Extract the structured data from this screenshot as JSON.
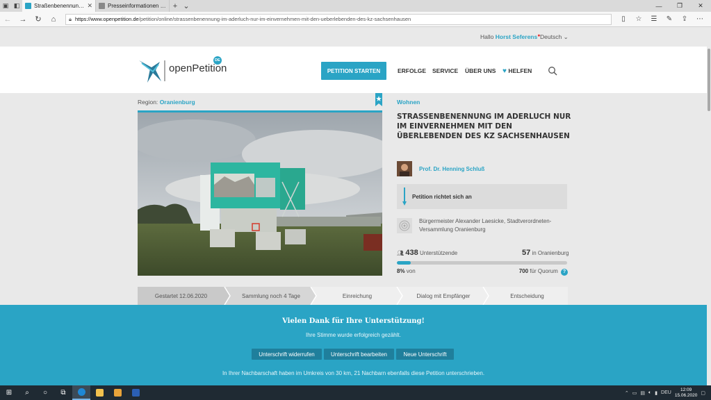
{
  "browser": {
    "tabs": [
      {
        "title": "Straßenbenennung im A",
        "active": true
      },
      {
        "title": "Presseinformationen - Stiftu",
        "active": false
      }
    ],
    "url_base": "https://www.openpetition.de",
    "url_path": "/petition/online/strassenbenennung-im-aderluch-nur-im-einvernehmen-mit-den-ueberlebenden-des-kz-sachsenhausen"
  },
  "userbar": {
    "greeting": "Hallo",
    "username": "Horst Seferens",
    "language": "Deutsch"
  },
  "header": {
    "logo_text": "openPetition",
    "logo_badge": "DE",
    "start_label": "PETITION STARTEN",
    "nav": [
      "ERFOLGE",
      "SERVICE",
      "ÜBER UNS",
      "HELFEN"
    ]
  },
  "petition": {
    "region_label": "Region:",
    "region": "Oranienburg",
    "category": "Wohnen",
    "title": "Straßenbenennung im Aderluch nur im Einvernehmen mit den Überlebenden des KZ Sachsenhausen",
    "author": "Prof. Dr. Henning Schluß",
    "target_label": "Petition richtet sich an",
    "recipient": "Bürgermeister Alexander Laesicke, Stadtverordneten-Versammlung Oranienburg"
  },
  "stats": {
    "supporters": "438",
    "supporters_label": "Unterstützende",
    "local": "57",
    "local_label": "in Oranienburg",
    "percent": "8%",
    "percent_label": "von",
    "progress": 0.08,
    "quorum": "700",
    "quorum_label": "für Quorum",
    "help": "?"
  },
  "stages": [
    {
      "label": "Gestartet 12.06.2020",
      "state": "done"
    },
    {
      "label": "Sammlung noch 4 Tage",
      "state": "current"
    },
    {
      "label": "Einreichung",
      "state": "future"
    },
    {
      "label": "Dialog mit Empfänger",
      "state": "future"
    },
    {
      "label": "Entscheidung",
      "state": "future"
    }
  ],
  "banner": {
    "thanks": "Vielen Dank für Ihre Unterstützung!",
    "success": "Ihre Stimme wurde erfolgreich gezählt.",
    "buttons": [
      "Unterschrift widerrufen",
      "Unterschrift bearbeiten",
      "Neue Unterschrift"
    ],
    "neighbors": "In Ihrer Nachbarschaft haben im Umkreis von 30 km, 21 Nachbarn ebenfalls diese Petition unterschrieben."
  },
  "taskbar": {
    "lang": "DEU",
    "time": "12:09",
    "date": "15.06.2020"
  },
  "colors": {
    "accent": "#2aa4c5",
    "button_dark": "#1f7f9c"
  }
}
